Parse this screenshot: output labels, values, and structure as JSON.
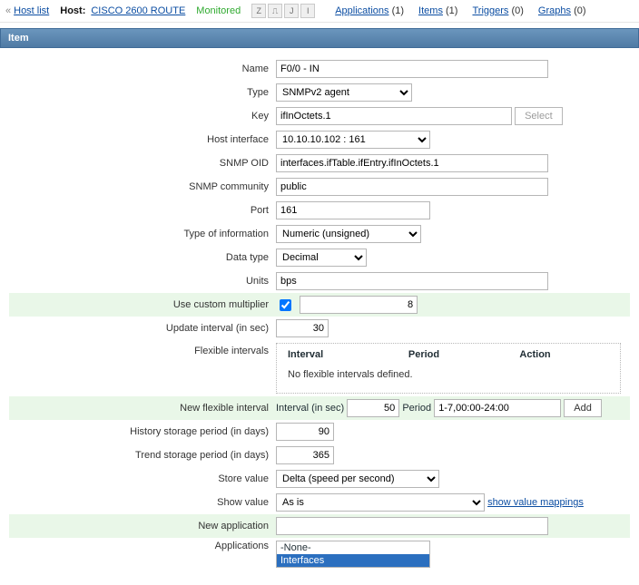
{
  "topbar": {
    "host_list_label": "Host list",
    "host_label": "Host:",
    "host_name": "CISCO 2600 ROUTE",
    "monitored_label": "Monitored",
    "links": {
      "applications_label": "Applications",
      "applications_count": "(1)",
      "items_label": "Items",
      "items_count": "(1)",
      "triggers_label": "Triggers",
      "triggers_count": "(0)",
      "graphs_label": "Graphs",
      "graphs_count": "(0)"
    }
  },
  "section_header": "Item",
  "form": {
    "labels": {
      "name": "Name",
      "type": "Type",
      "key": "Key",
      "host_interface": "Host interface",
      "snmp_oid": "SNMP OID",
      "snmp_community": "SNMP community",
      "port": "Port",
      "type_of_information": "Type of information",
      "data_type": "Data type",
      "units": "Units",
      "use_custom_multiplier": "Use custom multiplier",
      "update_interval": "Update interval (in sec)",
      "flexible_intervals": "Flexible intervals",
      "new_flexible_interval": "New flexible interval",
      "history_storage": "History storage period (in days)",
      "trend_storage": "Trend storage period (in days)",
      "store_value": "Store value",
      "show_value": "Show value",
      "new_application": "New application",
      "applications": "Applications"
    },
    "name": "F0/0 - IN",
    "type": "SNMPv2 agent",
    "key": "ifInOctets.1",
    "key_select_btn": "Select",
    "host_interface": "10.10.10.102 : 161",
    "snmp_oid": "interfaces.ifTable.ifEntry.ifInOctets.1",
    "snmp_community": "public",
    "port": "161",
    "type_of_information": "Numeric (unsigned)",
    "data_type": "Decimal",
    "units": "bps",
    "use_custom_multiplier_checked": true,
    "multiplier_value": "8",
    "update_interval": "30",
    "flex_panel": {
      "col_interval": "Interval",
      "col_period": "Period",
      "col_action": "Action",
      "none_defined": "No flexible intervals defined."
    },
    "new_flex": {
      "interval_label": "Interval (in sec)",
      "interval_value": "50",
      "period_label": "Period",
      "period_value": "1-7,00:00-24:00",
      "add_btn": "Add"
    },
    "history_storage": "90",
    "trend_storage": "365",
    "store_value": "Delta (speed per second)",
    "show_value": "As is",
    "show_value_mappings_link": "show value mappings",
    "new_application": "",
    "applications": {
      "options": [
        "-None-",
        "Interfaces"
      ],
      "selected": "Interfaces"
    }
  }
}
